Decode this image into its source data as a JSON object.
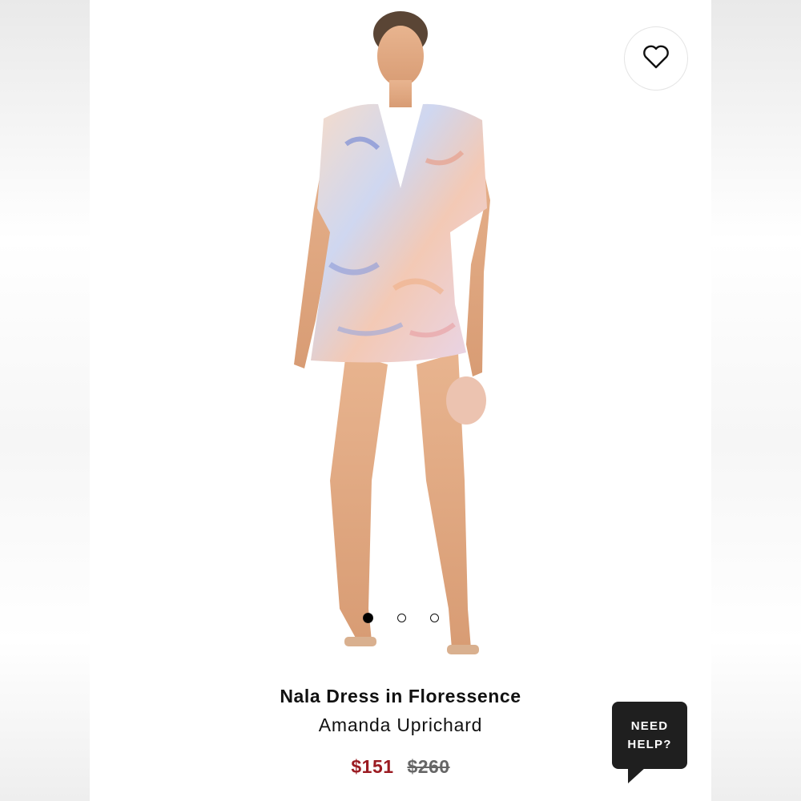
{
  "product": {
    "title": "Nala Dress in Floressence",
    "brand": "Amanda Uprichard",
    "sale_price": "$151",
    "original_price": "$260"
  },
  "carousel": {
    "slides": 3,
    "active_index": 0
  },
  "help": {
    "line1": "NEED",
    "line2": "HELP?"
  },
  "icons": {
    "favorite": "heart-outline-icon"
  },
  "colors": {
    "sale": "#9b1b22",
    "help_bg": "#1f1f1f"
  }
}
